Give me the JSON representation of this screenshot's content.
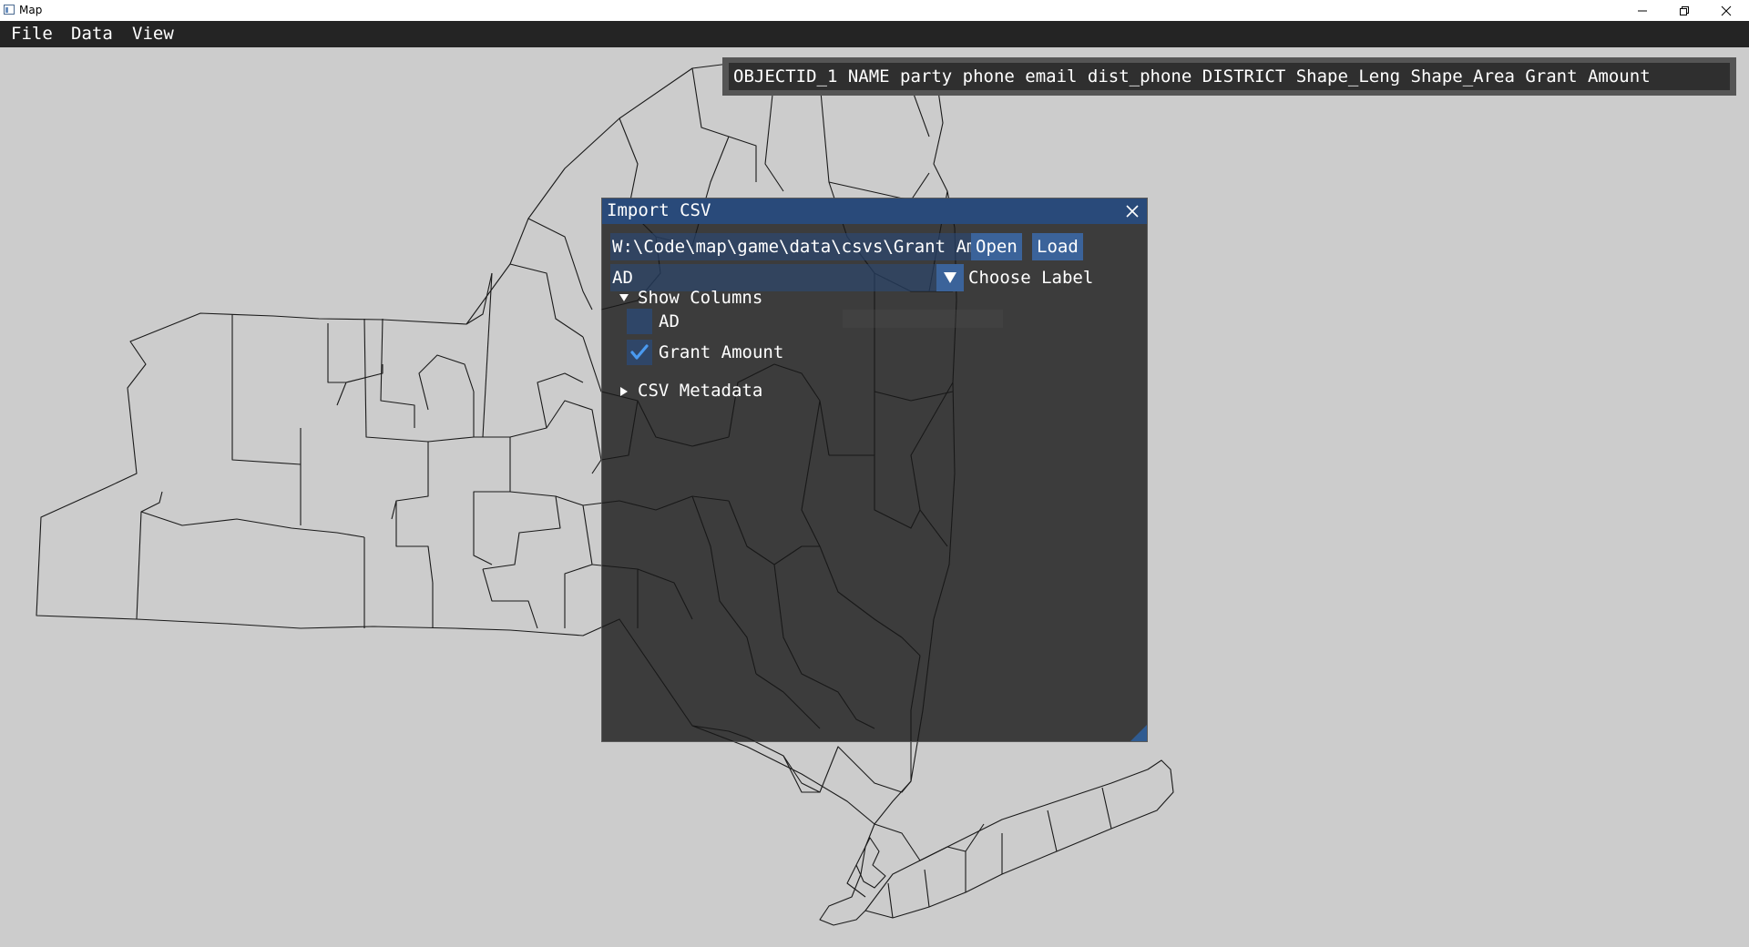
{
  "window": {
    "title": "Map",
    "controls": [
      "minimize-icon",
      "restore-icon",
      "close-icon"
    ]
  },
  "menubar": {
    "items": [
      "File",
      "Data",
      "View"
    ]
  },
  "columns_tooltip": {
    "text": "OBJECTID_1 NAME party phone email dist_phone DISTRICT Shape_Leng Shape_Area Grant Amount"
  },
  "import_csv": {
    "title": "Import CSV",
    "path_value": "W:\\Code\\map\\game\\data\\csvs\\Grant Amount.csv",
    "open_label": "Open",
    "load_label": "Load",
    "label_combo": {
      "selected": "AD",
      "label": "Choose Label"
    },
    "show_columns": {
      "label": "Show Columns",
      "expanded": true,
      "columns": [
        {
          "label": "AD",
          "checked": false
        },
        {
          "label": "Grant Amount",
          "checked": true
        }
      ]
    },
    "csv_metadata": {
      "label": "CSV Metadata",
      "expanded": false
    }
  },
  "colors": {
    "map_background": "#cccccc",
    "menubar": "#242424",
    "title_accent": "#294a7a",
    "button": "#3b639a",
    "check": "#4a9af0"
  }
}
